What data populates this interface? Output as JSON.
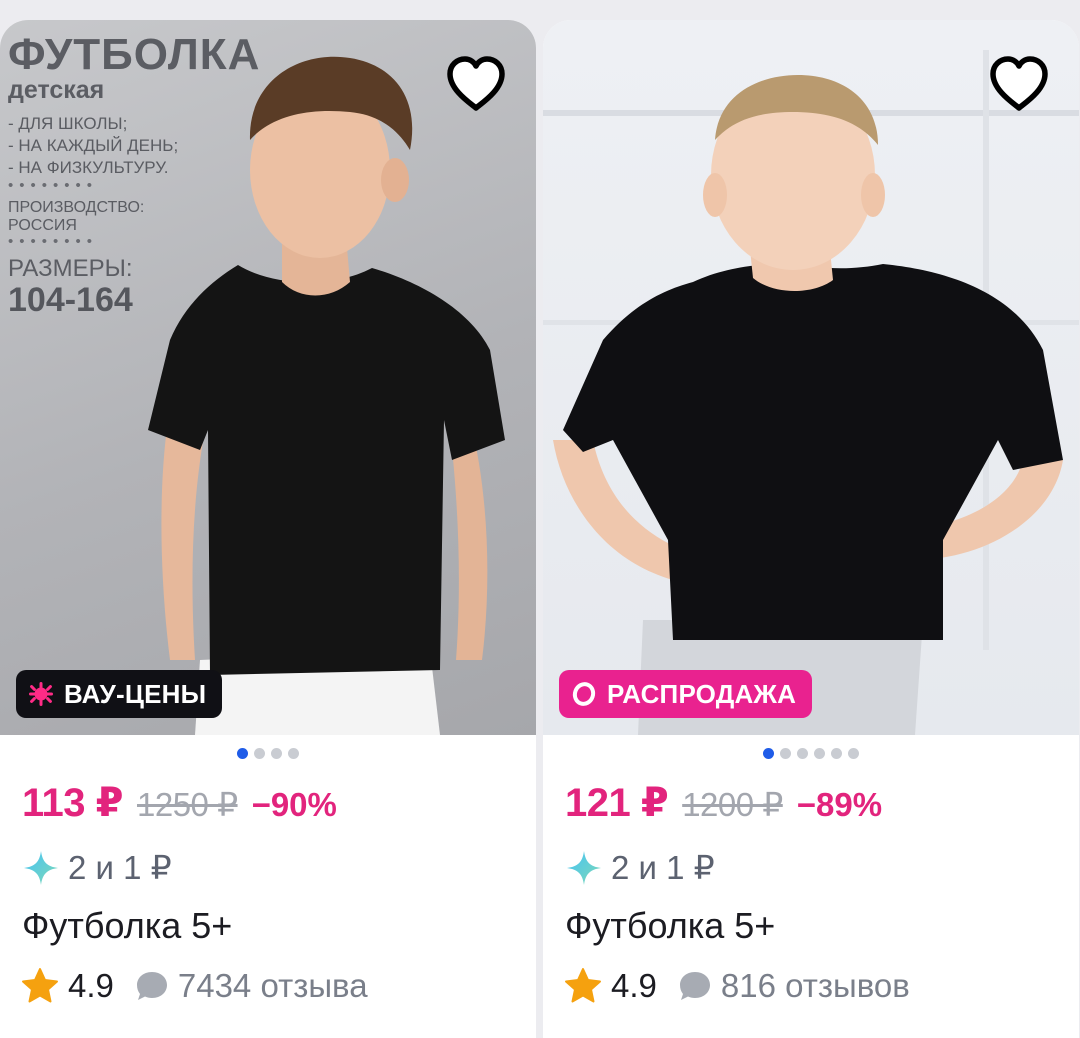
{
  "colors": {
    "accent": "#e2247d",
    "badge_dark": "#101015",
    "badge_pink": "#e9228f",
    "dot_active": "#1f5ce8",
    "dot_inactive": "#c9ccd2",
    "star": "#f5a10f"
  },
  "products": [
    {
      "photo_text": {
        "title": "ФУТБОЛКА",
        "subtitle": "детская",
        "list": [
          "- ДЛЯ ШКОЛЫ;",
          "- НА КАЖДЫЙ ДЕНЬ;",
          "- НА ФИЗКУЛЬТУРУ."
        ],
        "production_label": "ПРОИЗВОДСТВО:",
        "production_value": "РОССИЯ",
        "sizes_label": "РАЗМЕРЫ:",
        "sizes_value": "104-164"
      },
      "badge": {
        "label": "ВАУ-ЦЕНЫ",
        "icon": "splash-icon"
      },
      "gallery": {
        "count": 4,
        "active": 0
      },
      "price": "113 ₽",
      "old_price": "1250 ₽",
      "discount": "−90%",
      "bonus": "2 и 1 ₽",
      "title": "Футболка 5+",
      "rating": "4.9",
      "reviews": "7434 отзыва"
    },
    {
      "badge": {
        "label": "РАСПРОДАЖА",
        "icon": "ring-icon"
      },
      "gallery": {
        "count": 6,
        "active": 0
      },
      "price": "121 ₽",
      "old_price": "1200 ₽",
      "discount": "−89%",
      "bonus": "2 и 1 ₽",
      "title": "Футболка 5+",
      "rating": "4.9",
      "reviews": "816 отзывов"
    }
  ]
}
